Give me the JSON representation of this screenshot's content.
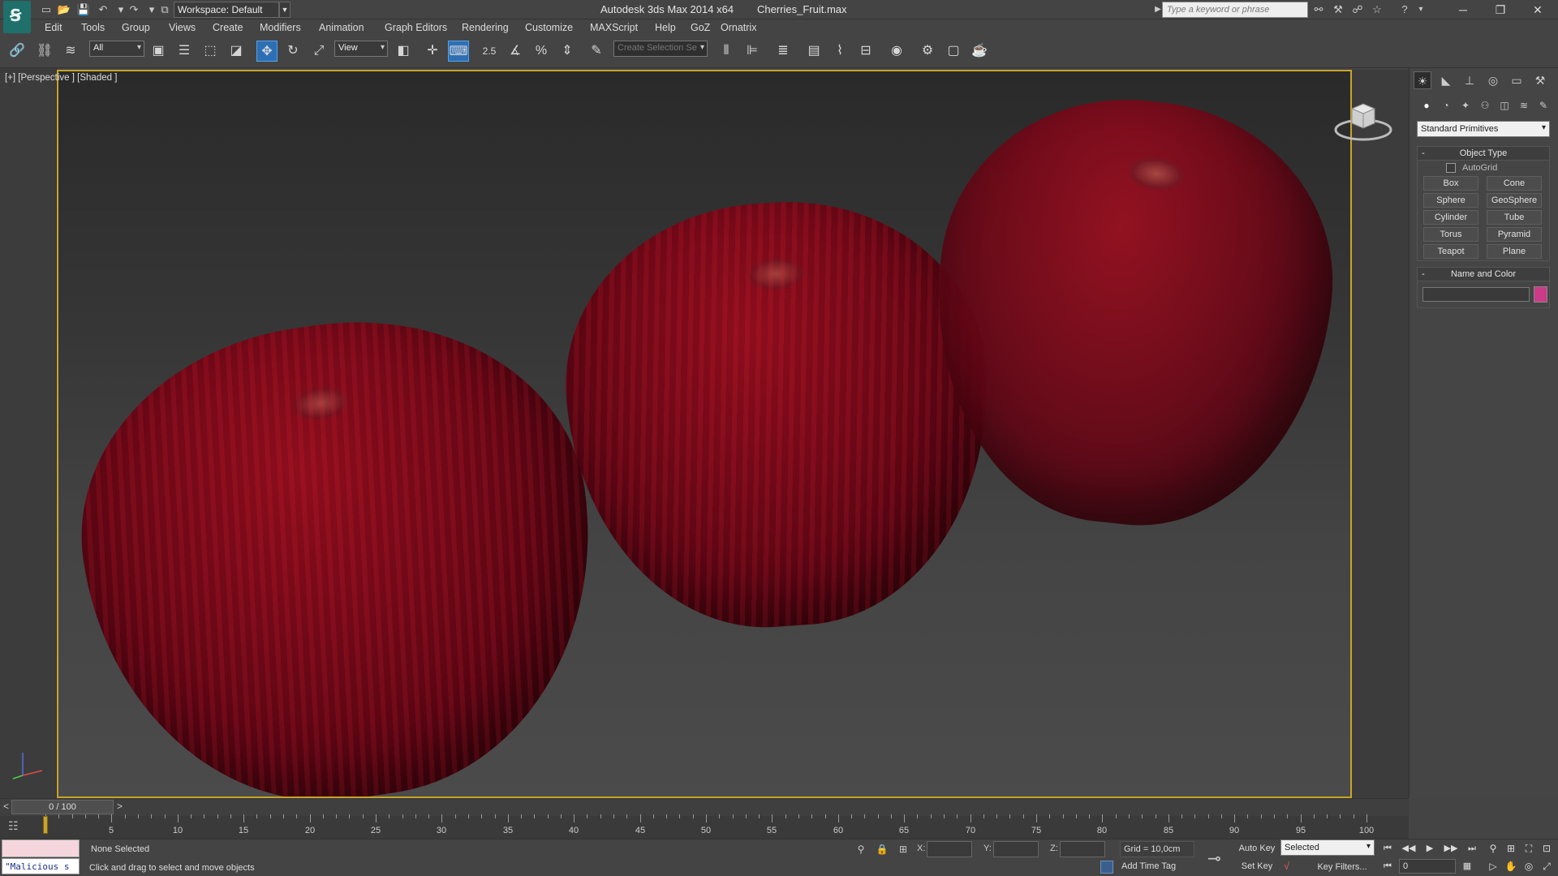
{
  "window": {
    "app_title": "Autodesk 3ds Max  2014 x64",
    "file_name": "Cherries_Fruit.max",
    "workspace": "Workspace: Default",
    "search_placeholder": "Type a keyword or phrase",
    "minimize": "─",
    "maximize": "❐",
    "close": "✕"
  },
  "menu": [
    "Edit",
    "Tools",
    "Group",
    "Views",
    "Create",
    "Modifiers",
    "Animation",
    "Graph Editors",
    "Rendering",
    "Customize",
    "MAXScript",
    "Help",
    "GoZ",
    "Ornatrix"
  ],
  "toolbar": {
    "filter_dropdown": "All",
    "coord_dropdown": "View",
    "snap_label": "2.5",
    "selection_set_placeholder": "Create Selection Se"
  },
  "viewport": {
    "label": "[+] [Perspective ] [Shaded ]",
    "active_border_color": "#c8a52a"
  },
  "command_panel": {
    "primitive_dropdown": "Standard Primitives",
    "object_type": {
      "title": "Object Type",
      "toggle": "-",
      "autogrid": "AutoGrid",
      "buttons": [
        "Box",
        "Cone",
        "Sphere",
        "GeoSphere",
        "Cylinder",
        "Tube",
        "Torus",
        "Pyramid",
        "Teapot",
        "Plane"
      ]
    },
    "name_and_color": {
      "title": "Name and Color",
      "toggle": "-",
      "swatch_color": "#cc3a8a"
    }
  },
  "timeline": {
    "frame_display": "0 / 100",
    "prev": "<",
    "next": ">",
    "current_frame": 0,
    "total_frames": 100,
    "ruler_labels": [
      "5",
      "10",
      "15",
      "20",
      "25",
      "30",
      "35",
      "40",
      "45",
      "50",
      "55",
      "60",
      "65",
      "70",
      "75",
      "80",
      "85",
      "90",
      "95",
      "100"
    ]
  },
  "status": {
    "maxscript_text": "\"Malicious s",
    "selection": "None Selected",
    "prompt": "Click and drag to select and move objects",
    "x_label": "X:",
    "y_label": "Y:",
    "z_label": "Z:",
    "grid": "Grid = 10,0cm",
    "add_time_tag": "Add Time Tag",
    "auto_key": "Auto Key",
    "set_key": "Set Key",
    "selected_dropdown": "Selected",
    "key_filters": "Key Filters...",
    "frame_field": "0"
  }
}
